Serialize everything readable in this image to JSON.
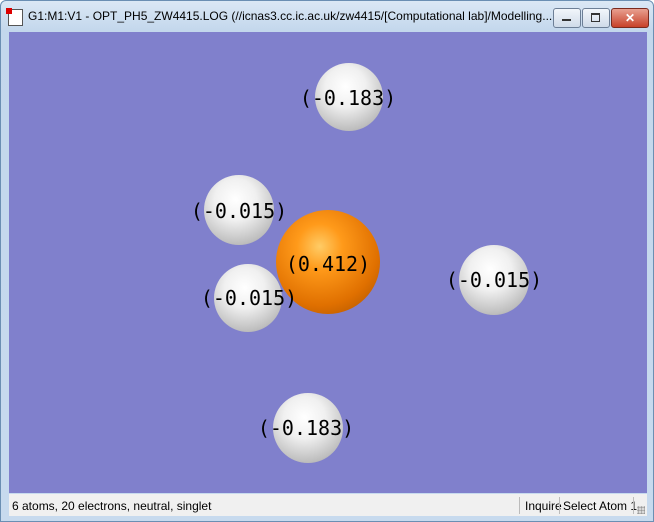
{
  "window": {
    "title": "G1:M1:V1 - OPT_PH5_ZW4415.LOG (//icnas3.cc.ic.ac.uk/zw4415/[Computational lab]/Modelling...",
    "close_glyph": "✕"
  },
  "molecule": {
    "background_color": "#8080cc",
    "atoms": [
      {
        "element": "H",
        "charge_label": "(-0.183)"
      },
      {
        "element": "H",
        "charge_label": "(-0.015)"
      },
      {
        "element": "P",
        "charge_label": "(0.412)"
      },
      {
        "element": "H",
        "charge_label": "(-0.015)"
      },
      {
        "element": "H",
        "charge_label": "(-0.015)"
      },
      {
        "element": "H",
        "charge_label": "(-0.183)"
      }
    ]
  },
  "statusbar": {
    "info": "6 atoms, 20 electrons, neutral, singlet",
    "mode": "Inquire",
    "action": "Select Atom 1"
  }
}
